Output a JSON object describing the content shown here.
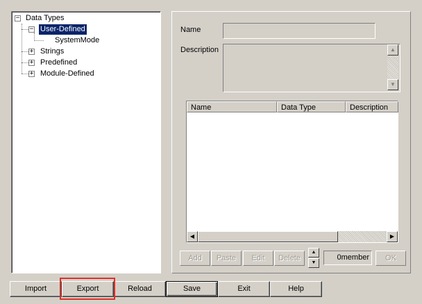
{
  "tree": {
    "root": "Data Types",
    "items": [
      {
        "label": "User-Defined",
        "expanded": true,
        "selected": true,
        "children": [
          "SystemMode"
        ]
      },
      {
        "label": "Strings",
        "expanded": false
      },
      {
        "label": "Predefined",
        "expanded": false
      },
      {
        "label": "Module-Defined",
        "expanded": false
      }
    ]
  },
  "form": {
    "name_label": "Name",
    "name_value": "",
    "description_label": "Description",
    "description_value": ""
  },
  "members_table": {
    "columns": [
      "Name",
      "Data Type",
      "Description"
    ],
    "rows": []
  },
  "member_buttons": {
    "add": "Add",
    "paste": "Paste",
    "edit": "Edit",
    "delete": "Delete",
    "member_count": "0member",
    "ok": "OK"
  },
  "bottom_buttons": {
    "import": "Import",
    "export": "Export",
    "reload": "Reload",
    "save": "Save",
    "exit": "Exit",
    "help": "Help"
  },
  "icons": {
    "expanded": "minus-box-icon",
    "collapsed": "plus-box-icon"
  },
  "colors": {
    "selection": "#0a246a",
    "highlight": "#e03028",
    "face": "#d4d0c8"
  }
}
